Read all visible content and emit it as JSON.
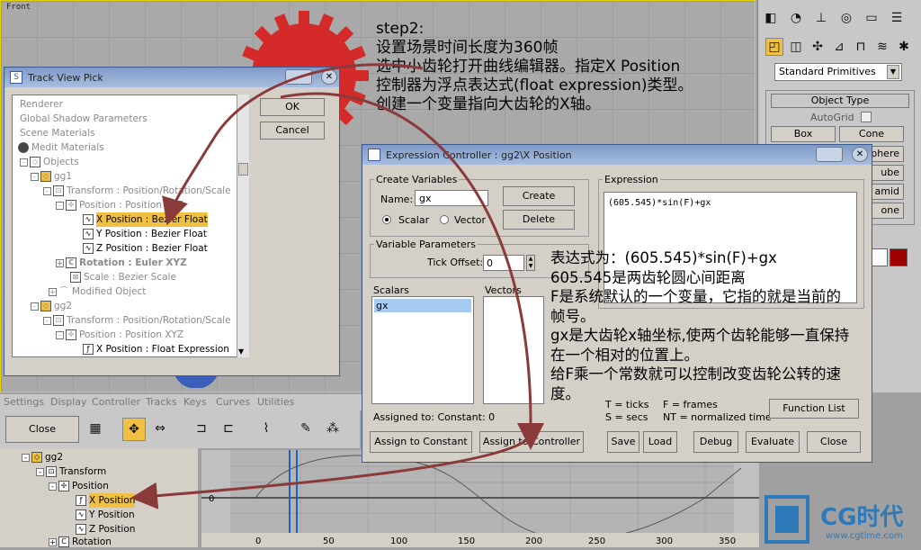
{
  "viewport": {
    "label": "Front"
  },
  "step": {
    "lines": [
      "step2:",
      "设置场景时间长度为360帧",
      "选中小齿轮打开曲线编辑器。指定X   Position",
      "控制器为浮点表达式(float expression)类型。",
      "创建一个变量指向大齿轮的X轴。"
    ]
  },
  "cmd_panel": {
    "dropdown": "Standard Primitives",
    "object_type_title": "Object Type",
    "autogrid": "AutoGrid",
    "buttons": [
      "Box",
      "Cone",
      "phere",
      "ube",
      "amid",
      "one"
    ]
  },
  "track_view_pick": {
    "title": "Track View Pick",
    "ok": "OK",
    "cancel": "Cancel",
    "rows": [
      {
        "label": "Renderer"
      },
      {
        "label": "Global Shadow Parameters"
      },
      {
        "label": "Scene Materials"
      },
      {
        "label": "Medit Materials"
      },
      {
        "label": "Objects"
      },
      {
        "label": "gg1"
      },
      {
        "label": "Transform : Position/Rotation/Scale"
      },
      {
        "label": "Position : Position XYZ"
      },
      {
        "label": "X Position : Bezier Float"
      },
      {
        "label": "Y Position : Bezier Float"
      },
      {
        "label": "Z Position : Bezier Float"
      },
      {
        "label": "Rotation : Euler XYZ"
      },
      {
        "label": "Scale : Bezier Scale"
      },
      {
        "label": "Modified Object"
      },
      {
        "label": "gg2"
      },
      {
        "label": "Transform : Position/Rotation/Scale"
      },
      {
        "label": "Position : Position XYZ"
      },
      {
        "label": "X Position : Float Expression"
      }
    ]
  },
  "expr_ctrl": {
    "title": "Expression Controller : gg2\\X Position",
    "create_variables": "Create Variables",
    "name_label": "Name:",
    "name_value": "gx",
    "create": "Create",
    "delete": "Delete",
    "scalar": "Scalar",
    "vector": "Vector",
    "variable_parameters": "Variable Parameters",
    "tick_offset": "Tick Offset:",
    "tick_value": "0",
    "scalars": "Scalars",
    "vectors": "Vectors",
    "scalar_items": [
      "gx"
    ],
    "expression_label": "Expression",
    "expression": "(605.545)*sin(F)+gx",
    "assigned_to": "Assigned to:  Constant: 0",
    "legend1": "T = ticks",
    "legend2": "F = frames",
    "legend3": "S = secs",
    "legend4": "NT = normalized time",
    "function_list": "Function List",
    "assign_constant": "Assign to Constant",
    "assign_controller": "Assign to Controller",
    "save": "Save",
    "load": "Load",
    "debug": "Debug",
    "evaluate": "Evaluate",
    "close": "Close"
  },
  "annotation": {
    "lines": [
      "表达式为：(605.545)*sin(F)+gx",
      "605.545是两齿轮圆心间距离",
      "F是系统默认的一个变量，它指的就是当前的",
      "帧号。",
      "gx是大齿轮x轴坐标,使两个齿轮能够一直保持",
      "在一个相对的位置上。",
      "给F乘一个常数就可以控制改变齿轮公转的速",
      "度。"
    ]
  },
  "menubar": [
    "Settings",
    "Display",
    "Controller",
    "Tracks",
    "Keys",
    "Curves",
    "Utilities"
  ],
  "tv_toolbar": {
    "close": "Close"
  },
  "tree_bottom": [
    "gg2",
    "Transform",
    "Position",
    "X Position",
    "Y Position",
    "Z Position",
    "Rotation"
  ],
  "curve": {
    "zero_label": "0",
    "ruler": [
      "0",
      "50",
      "100",
      "150",
      "200",
      "250",
      "300",
      "350"
    ]
  },
  "logo": {
    "brand": "CG时代",
    "url": "www.cgtime.com"
  }
}
